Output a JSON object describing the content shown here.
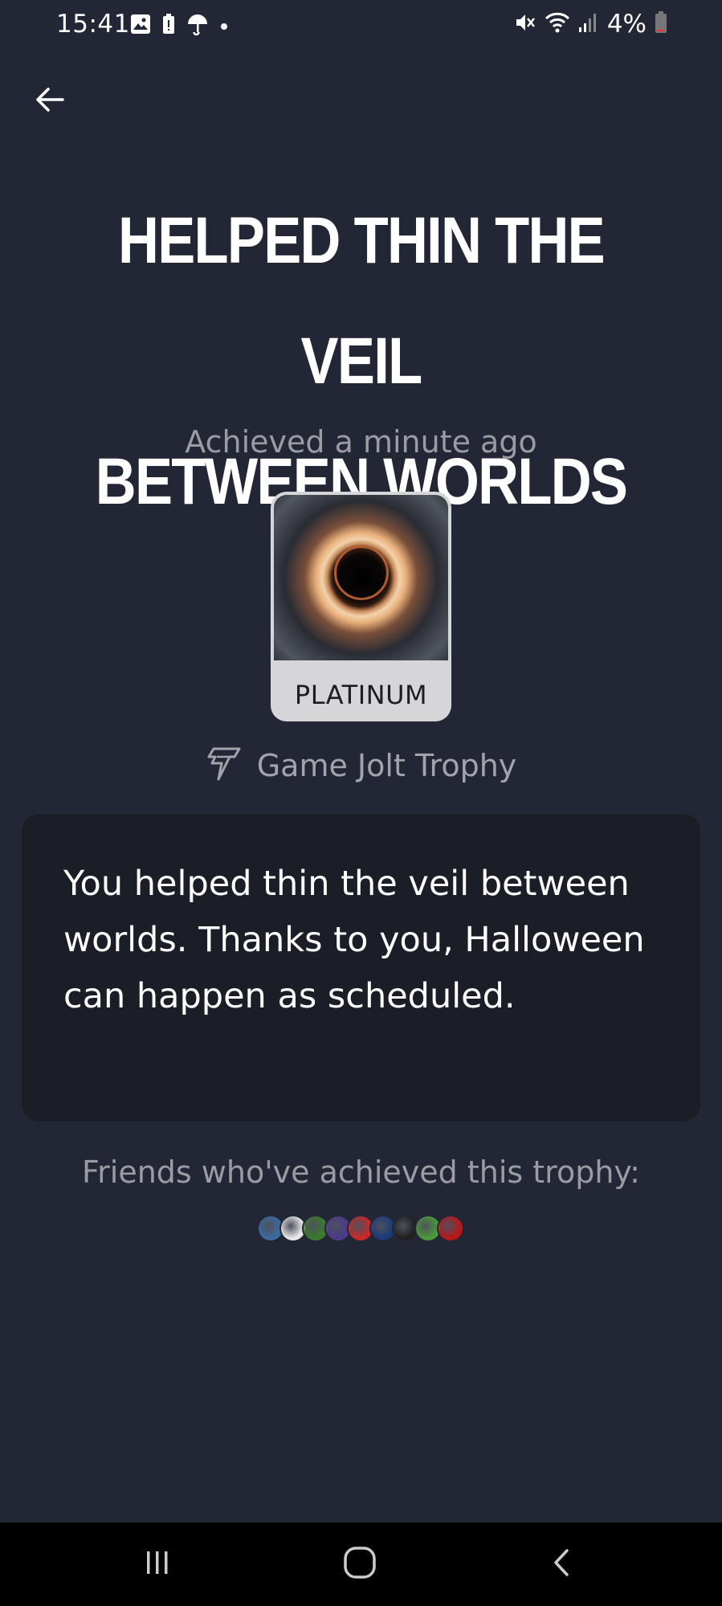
{
  "status_bar": {
    "time": "15:41",
    "battery": "4%",
    "left_icons": [
      "gallery-icon",
      "battery-alert-icon",
      "umbrella-icon",
      "dot-icon"
    ],
    "right_icons": [
      "mute-icon",
      "wifi-icon",
      "signal-icon",
      "battery-icon"
    ]
  },
  "header": {
    "back_icon": "back-arrow-icon"
  },
  "trophy": {
    "title_line1": "HELPED THIN THE VEIL",
    "title_line2": "BETWEEN WORLDS",
    "achieved": "Achieved a minute ago",
    "tier": "PLATINUM",
    "source": "Game Jolt Trophy",
    "source_icon": "game-jolt-icon",
    "description": "You helped thin the veil between worlds. Thanks to you, Halloween can happen as scheduled."
  },
  "friends": {
    "label": "Friends who've achieved this trophy:",
    "avatar_colors": [
      "#3b6aa0",
      "#e8e8e8",
      "#3a7a2a",
      "#4a3a8a",
      "#c82828",
      "#1a3a7a",
      "#202020",
      "#4a9a3a",
      "#b81818"
    ]
  },
  "nav_bar": {
    "icons": [
      "recent-apps-icon",
      "home-icon",
      "back-icon"
    ]
  }
}
